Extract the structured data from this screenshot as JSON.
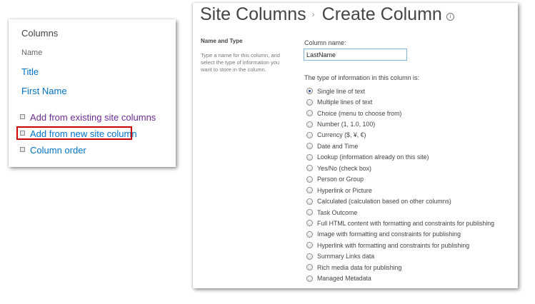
{
  "left_panel": {
    "title": "Columns",
    "sub_header": "Name",
    "fields": [
      "Title",
      "First Name"
    ],
    "links": {
      "add_existing": "Add from existing site columns",
      "add_new": "Add from new site column",
      "column_order": "Column order"
    }
  },
  "right_panel": {
    "breadcrumb_parent": "Site Columns",
    "breadcrumb_separator": "›",
    "page_title": "Create Column",
    "section_title": "Name and Type",
    "section_description": "Type a name for this column, and select the type of information you want to store in the column.",
    "column_name_label": "Column name:",
    "column_name_value": "LastName",
    "type_label": "The type of information in this column is:",
    "types": [
      "Single line of text",
      "Multiple lines of text",
      "Choice (menu to choose from)",
      "Number (1, 1.0, 100)",
      "Currency ($, ¥, €)",
      "Date and Time",
      "Lookup (information already on this site)",
      "Yes/No (check box)",
      "Person or Group",
      "Hyperlink or Picture",
      "Calculated (calculation based on other columns)",
      "Task Outcome",
      "Full HTML content with formatting and constraints for publishing",
      "Image with formatting and constraints for publishing",
      "Hyperlink with formatting and constraints for publishing",
      "Summary Links data",
      "Rich media data for publishing",
      "Managed Metadata"
    ],
    "selected_type_index": 0
  },
  "colors": {
    "link_blue": "#0072c6",
    "visited_purple": "#6b2c91",
    "highlight_red": "#cc0000"
  }
}
